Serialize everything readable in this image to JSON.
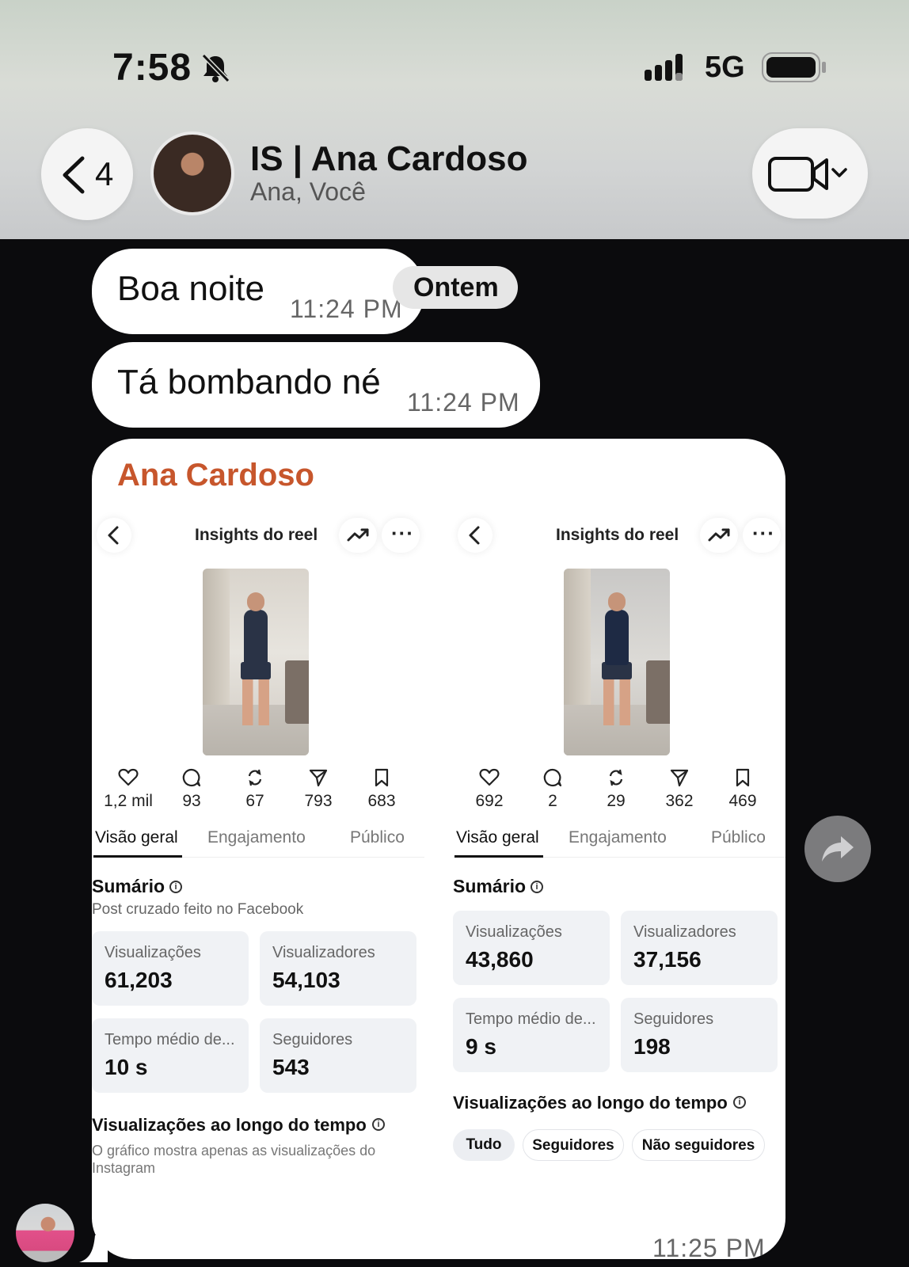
{
  "status_bar": {
    "time": "7:58",
    "network": "5G"
  },
  "chat_header": {
    "back_count": "4",
    "title": "IS | Ana Cardoso",
    "subtitle": "Ana, Você"
  },
  "date_chip": "Ontem",
  "messages": [
    {
      "text": "Boa noite",
      "time": "11:24 PM"
    },
    {
      "text": "Tá bombando né",
      "time": "11:24 PM"
    }
  ],
  "shared_card": {
    "sender": "Ana Cardoso",
    "time": "11:25 PM",
    "panels": [
      {
        "header_title": "Insights do reel",
        "stats": [
          {
            "icon": "heart-icon",
            "value": "1,2 mil"
          },
          {
            "icon": "comment-icon",
            "value": "93"
          },
          {
            "icon": "repost-icon",
            "value": "67"
          },
          {
            "icon": "share-icon",
            "value": "793"
          },
          {
            "icon": "save-icon",
            "value": "683"
          }
        ],
        "tabs": [
          "Visão geral",
          "Engajamento",
          "Público"
        ],
        "summary_title": "Sumário",
        "summary_note": "Post cruzado feito no Facebook",
        "tiles": [
          {
            "label": "Visualizações",
            "value": "61,203"
          },
          {
            "label": "Visualizadores",
            "value": "54,103"
          },
          {
            "label": "Tempo médio de...",
            "value": "10 s"
          },
          {
            "label": "Seguidores",
            "value": "543"
          }
        ],
        "views_title": "Visualizações ao longo do tempo",
        "views_note": "O gráfico mostra apenas as visualizações do Instagram"
      },
      {
        "header_title": "Insights do reel",
        "stats": [
          {
            "icon": "heart-icon",
            "value": "692"
          },
          {
            "icon": "comment-icon",
            "value": "2"
          },
          {
            "icon": "repost-icon",
            "value": "29"
          },
          {
            "icon": "share-icon",
            "value": "362"
          },
          {
            "icon": "save-icon",
            "value": "469"
          }
        ],
        "tabs": [
          "Visão geral",
          "Engajamento",
          "Público"
        ],
        "summary_title": "Sumário",
        "tiles": [
          {
            "label": "Visualizações",
            "value": "43,860"
          },
          {
            "label": "Visualizadores",
            "value": "37,156"
          },
          {
            "label": "Tempo médio de...",
            "value": "9 s"
          },
          {
            "label": "Seguidores",
            "value": "198"
          }
        ],
        "views_title": "Visualizações ao longo do tempo",
        "filters": [
          "Tudo",
          "Seguidores",
          "Não seguidores"
        ]
      }
    ]
  },
  "colors": {
    "sender": "#c7562c",
    "background": "#0b0b0d",
    "bubble": "#ffffff"
  }
}
